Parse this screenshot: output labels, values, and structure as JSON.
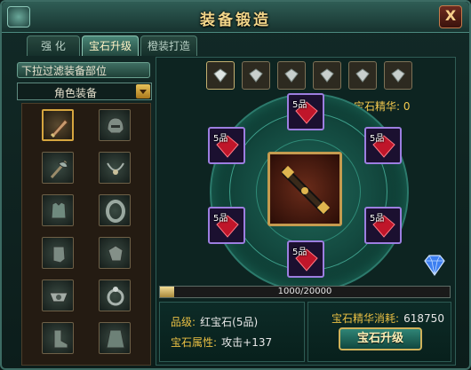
{
  "window": {
    "title": "装备锻造",
    "close_label": "X"
  },
  "tabs": [
    {
      "label": "强  化",
      "active": false
    },
    {
      "label": "宝石升级",
      "active": true
    },
    {
      "label": "橙装打造",
      "active": false
    }
  ],
  "filter": {
    "header": "下拉过滤装备部位",
    "selected": "角色装备"
  },
  "equipment": [
    {
      "icon": "dagger-icon",
      "selected": true
    },
    {
      "icon": "helmet-icon",
      "selected": false
    },
    {
      "icon": "axe-icon",
      "selected": false
    },
    {
      "icon": "necklace-icon",
      "selected": false
    },
    {
      "icon": "armor-icon",
      "selected": false
    },
    {
      "icon": "bracelet-icon",
      "selected": false
    },
    {
      "icon": "gauntlet-icon",
      "selected": false
    },
    {
      "icon": "glove-icon",
      "selected": false
    },
    {
      "icon": "belt-icon",
      "selected": false
    },
    {
      "icon": "ring-icon",
      "selected": false
    },
    {
      "icon": "boot-icon",
      "selected": false
    },
    {
      "icon": "cape-icon",
      "selected": false
    }
  ],
  "top_gem_slots": [
    {
      "icon": "white-gem-icon",
      "selected": true
    },
    {
      "icon": "white-gem-icon",
      "selected": false
    },
    {
      "icon": "white-gem-icon",
      "selected": false
    },
    {
      "icon": "white-gem-icon",
      "selected": false
    },
    {
      "icon": "white-gem-icon",
      "selected": false
    },
    {
      "icon": "white-gem-icon",
      "selected": false
    }
  ],
  "essence": {
    "label": "宝石精华",
    "value": "0"
  },
  "gem_slots": [
    {
      "label": "5品",
      "icon": "red-gem-icon"
    },
    {
      "label": "5品",
      "icon": "red-gem-icon"
    },
    {
      "label": "5品",
      "icon": "red-gem-icon"
    },
    {
      "label": "5品",
      "icon": "red-gem-icon"
    },
    {
      "label": "5品",
      "icon": "red-gem-icon"
    },
    {
      "label": "5品",
      "icon": "red-gem-icon"
    }
  ],
  "center_item": {
    "icon": "staff-icon"
  },
  "progress": {
    "current": 1000,
    "max": 20000,
    "text": "1000/20000"
  },
  "gem_info": {
    "grade_label": "品级:",
    "grade_value": "红宝石(5品)",
    "attr_label": "宝石属性:",
    "attr_value": "攻击+137"
  },
  "cost": {
    "label": "宝石精华消耗:",
    "value": "618750"
  },
  "upgrade_button": "宝石升级",
  "colors": {
    "accent_gold": "#e9bf43",
    "gem_border": "#9c7ee0",
    "title": "#f4d78a"
  }
}
